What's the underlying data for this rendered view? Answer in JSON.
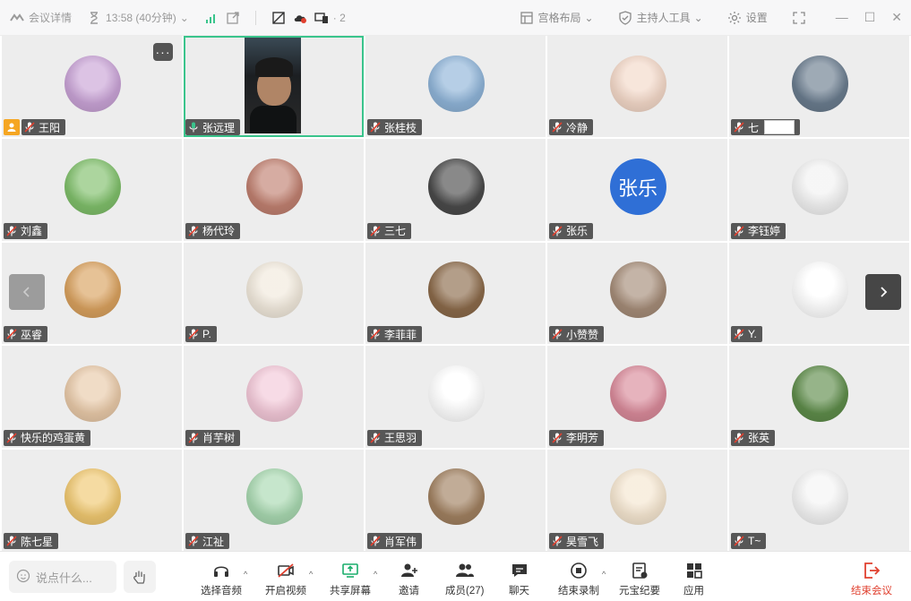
{
  "topbar": {
    "meeting_details": "会议详情",
    "timer": "13:58 (40分钟)",
    "participants_badge": "2",
    "layout_label": "宫格布局",
    "host_tools_label": "主持人工具",
    "settings_label": "设置"
  },
  "tiles": [
    {
      "name": "王阳",
      "avatar_color": "#c9a3d6"
    },
    {
      "name": "张远理",
      "avatar_color": "#2a2a2a"
    },
    {
      "name": "张桂枝",
      "avatar_color": "#8fb4d8"
    },
    {
      "name": "冷静",
      "avatar_color": "#f3d8c8"
    },
    {
      "name": "七",
      "avatar_color": "#6a7c8e"
    },
    {
      "name": "刘鑫",
      "avatar_color": "#7fbf6a"
    },
    {
      "name": "杨代玲",
      "avatar_color": "#c08070"
    },
    {
      "name": "三七",
      "avatar_color": "#4a4a4a"
    },
    {
      "name": "张乐",
      "avatar_text": "张乐",
      "avatar_color": "#2f6fd6"
    },
    {
      "name": "李钰婷",
      "avatar_color": "#f2f2f2"
    },
    {
      "name": "巫睿",
      "avatar_color": "#d9a15e"
    },
    {
      "name": "P.",
      "avatar_color": "#f1e9dc"
    },
    {
      "name": "李菲菲",
      "avatar_color": "#8b6a4a"
    },
    {
      "name": "小赞赞",
      "avatar_color": "#a58c78"
    },
    {
      "name": "Y.",
      "avatar_color": "#ffffff"
    },
    {
      "name": "快乐的鸡蛋黄",
      "avatar_color": "#e8c9a8"
    },
    {
      "name": "肖芋树",
      "avatar_color": "#f3c8d8"
    },
    {
      "name": "王思羽",
      "avatar_color": "#ffffff"
    },
    {
      "name": "李明芳",
      "avatar_color": "#d98a9a"
    },
    {
      "name": "张英",
      "avatar_color": "#5e8c4a"
    },
    {
      "name": "陈七星",
      "avatar_color": "#f0c870"
    },
    {
      "name": "江祉",
      "avatar_color": "#a8d8b0"
    },
    {
      "name": "肖军伟",
      "avatar_color": "#a08060"
    },
    {
      "name": "昊雪飞",
      "avatar_color": "#f5e6d0"
    },
    {
      "name": "T~",
      "avatar_color": "#f4f4f4"
    }
  ],
  "bottombar": {
    "chat_placeholder": "说点什么...",
    "audio": "选择音频",
    "video": "开启视频",
    "share": "共享屏幕",
    "invite": "邀请",
    "members": "成员(27)",
    "chat": "聊天",
    "record": "结束录制",
    "minutes": "元宝纪要",
    "apps": "应用",
    "end": "结束会议"
  },
  "colors": {
    "speaking_border": "#3ac48c",
    "end_meeting": "#e0402f",
    "host_badge": "#f5a623",
    "share_icon": "#1aad6b"
  }
}
